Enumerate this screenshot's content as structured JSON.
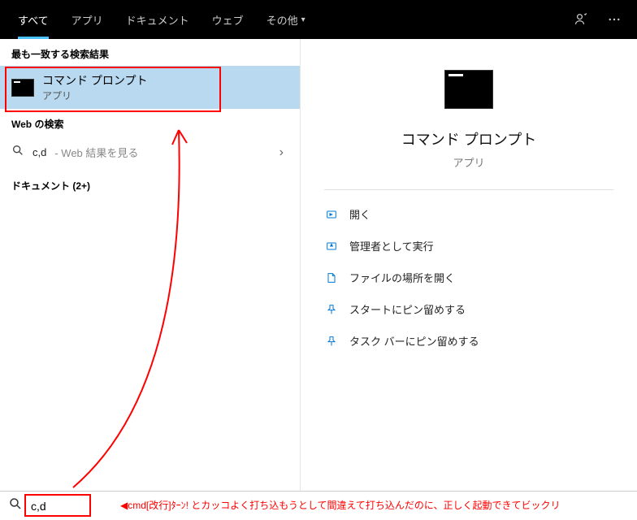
{
  "tabs": {
    "all": "すべて",
    "apps": "アプリ",
    "docs": "ドキュメント",
    "web": "ウェブ",
    "more": "その他"
  },
  "left": {
    "best_match_label": "最も一致する検索結果",
    "best": {
      "title": "コマンド プロンプト",
      "sub": "アプリ"
    },
    "web_search_label": "Web の検索",
    "web": {
      "query": "c,d",
      "hint": " - Web 結果を見る"
    },
    "docs_label": "ドキュメント (2+)"
  },
  "preview": {
    "title": "コマンド プロンプト",
    "sub": "アプリ",
    "actions": {
      "open": "開く",
      "run_admin": "管理者として実行",
      "open_location": "ファイルの場所を開く",
      "pin_start": "スタートにピン留めする",
      "pin_taskbar": "タスク バーにピン留めする"
    }
  },
  "search": {
    "value": "c,d"
  },
  "annotation": "◀cmd[改行]ﾀｰﾝ! とカッコよく打ち込もうとして間違えて打ち込んだのに、正しく起動できてビックリ"
}
